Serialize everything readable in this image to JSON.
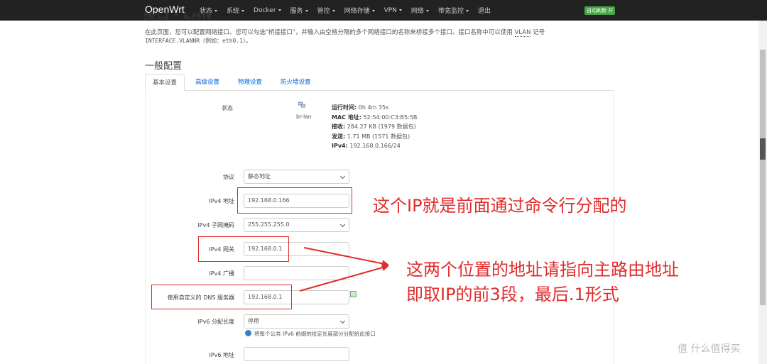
{
  "nav": {
    "brand": "OpenWrt",
    "items": [
      "状态",
      "系统",
      "Docker",
      "服务",
      "管控",
      "网络存储",
      "VPN",
      "网络",
      "带宽监控",
      "退出"
    ],
    "auto_refresh": "自动刷新 开"
  },
  "page": {
    "title": "接口 - LAN",
    "desc_line1_pre": "在此页面，您可以配置网络接口。您可以勾选\"桥接接口\"，并输入由空格分隔的多个网络接口的名称来桥接多个接口。接口名称中可以使用",
    "desc_line1_link": "VLAN",
    "desc_line1_post": "记号",
    "desc_line2": "INTERFACE.VLANNR（例如：eth0.1）。",
    "section_title": "一般配置"
  },
  "tabs": [
    "基本设置",
    "高级设置",
    "物理设置",
    "防火墙设置"
  ],
  "status": {
    "label": "状态",
    "iface": "br-lan",
    "uptime_label": "运行时间:",
    "uptime": "0h 4m 35s",
    "mac_label": "MAC 地址:",
    "mac": "52:54:00:C3:B5:5B",
    "rx_label": "接收:",
    "rx": "284.27 KB (1979 数据包)",
    "tx_label": "发送:",
    "tx": "1.71 MB (1571 数据包)",
    "ipv4_label": "IPv4:",
    "ipv4": "192.168.0.166/24"
  },
  "form": {
    "protocol_label": "协议",
    "protocol_value": "静态地址",
    "ipv4_addr_label": "IPv4 地址",
    "ipv4_addr_value": "192.168.0.166",
    "netmask_label": "IPv4 子网掩码",
    "netmask_value": "255.255.255.0",
    "gateway_label": "IPv4 网关",
    "gateway_value": "192.168.0.1",
    "broadcast_label": "IPv4 广播",
    "broadcast_value": "",
    "dns_label": "使用自定义的 DNS 服务器",
    "dns_value": "192.168.0.1",
    "ipv6_assign_label": "IPv6 分配长度",
    "ipv6_assign_value": "停用",
    "ipv6_assign_hint": "将每个公共 IPv6 前缀的给定长度部分分配给此接口",
    "ipv6_addr_label": "IPv6 地址",
    "ipv6_addr_value": ""
  },
  "annotations": {
    "note1": "这个IP就是前面通过命令行分配的",
    "note2_line1": "这两个位置的地址请指向主路由地址",
    "note2_line2": "即取IP的前3段，最后.1形式",
    "color": "#e02c2c"
  },
  "watermark": "值 什么值得买",
  "watermark_icon": "值"
}
